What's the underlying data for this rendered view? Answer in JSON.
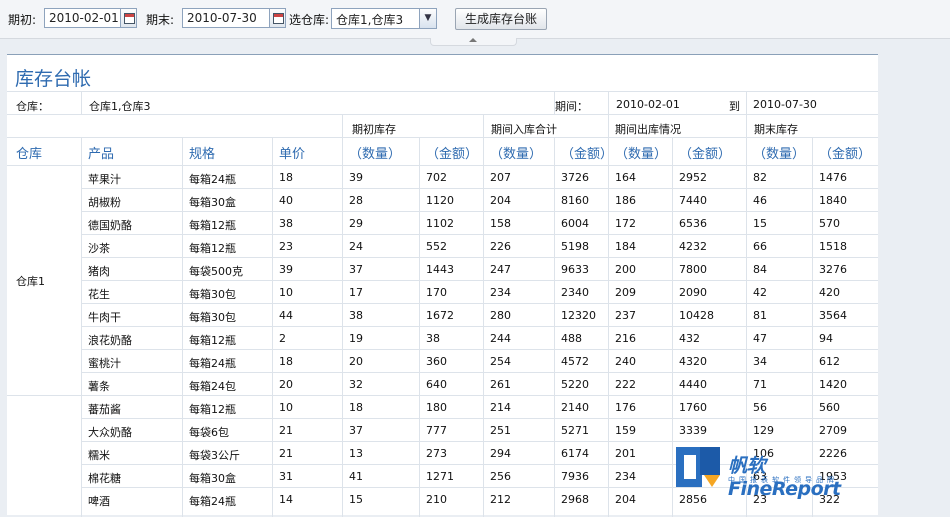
{
  "toolbar": {
    "start_label": "期初:",
    "start_value": "2010-02-01",
    "end_label": "期末:",
    "end_value": "2010-07-30",
    "warehouse_label": "选仓库:",
    "warehouse_value": "仓库1,仓库3",
    "generate_button": "生成库存台账"
  },
  "report": {
    "title": "库存台帐",
    "warehouse_label": "仓库：",
    "warehouse_value": "仓库1,仓库3",
    "period_label": "期间：",
    "period_start": "2010-02-01",
    "to_label": "到",
    "period_end": "2010-07-30",
    "group_headers": [
      "期初库存",
      "期间入库合计",
      "期间出库情况",
      "期末库存"
    ],
    "columns": [
      "仓库",
      "产品",
      "规格",
      "单价",
      "（数量）",
      "（金额）",
      "（数量）",
      "（金额）",
      "（数量）",
      "（金额）",
      "（数量）",
      "（金额）"
    ],
    "groups": [
      {
        "warehouse": "仓库1",
        "rows": [
          [
            "苹果汁",
            "每箱24瓶",
            "18",
            "39",
            "702",
            "207",
            "3726",
            "164",
            "2952",
            "82",
            "1476"
          ],
          [
            "胡椒粉",
            "每箱30盒",
            "40",
            "28",
            "1120",
            "204",
            "8160",
            "186",
            "7440",
            "46",
            "1840"
          ],
          [
            "德国奶酪",
            "每箱12瓶",
            "38",
            "29",
            "1102",
            "158",
            "6004",
            "172",
            "6536",
            "15",
            "570"
          ],
          [
            "沙茶",
            "每箱12瓶",
            "23",
            "24",
            "552",
            "226",
            "5198",
            "184",
            "4232",
            "66",
            "1518"
          ],
          [
            "猪肉",
            "每袋500克",
            "39",
            "37",
            "1443",
            "247",
            "9633",
            "200",
            "7800",
            "84",
            "3276"
          ],
          [
            "花生",
            "每箱30包",
            "10",
            "17",
            "170",
            "234",
            "2340",
            "209",
            "2090",
            "42",
            "420"
          ],
          [
            "牛肉干",
            "每箱30包",
            "44",
            "38",
            "1672",
            "280",
            "12320",
            "237",
            "10428",
            "81",
            "3564"
          ],
          [
            "浪花奶酪",
            "每箱12瓶",
            "2",
            "19",
            "38",
            "244",
            "488",
            "216",
            "432",
            "47",
            "94"
          ],
          [
            "蜜桃汁",
            "每箱24瓶",
            "18",
            "20",
            "360",
            "254",
            "4572",
            "240",
            "4320",
            "34",
            "612"
          ],
          [
            "薯条",
            "每箱24包",
            "20",
            "32",
            "640",
            "261",
            "5220",
            "222",
            "4440",
            "71",
            "1420"
          ]
        ]
      },
      {
        "warehouse": "",
        "rows": [
          [
            "蕃茄酱",
            "每箱12瓶",
            "10",
            "18",
            "180",
            "214",
            "2140",
            "176",
            "1760",
            "56",
            "560"
          ],
          [
            "大众奶酪",
            "每袋6包",
            "21",
            "37",
            "777",
            "251",
            "5271",
            "159",
            "3339",
            "129",
            "2709"
          ],
          [
            "糯米",
            "每袋3公斤",
            "21",
            "13",
            "273",
            "294",
            "6174",
            "201",
            "",
            "106",
            "2226"
          ],
          [
            "棉花糖",
            "每箱30盒",
            "31",
            "41",
            "1271",
            "256",
            "7936",
            "234",
            "",
            "63",
            "1953"
          ],
          [
            "啤酒",
            "每箱24瓶",
            "14",
            "15",
            "210",
            "212",
            "2968",
            "204",
            "2856",
            "23",
            "322"
          ]
        ]
      }
    ]
  },
  "watermark": {
    "brand": "帆软FineReport",
    "tagline": "中国报表软件领导品牌"
  },
  "colors": {
    "accent": "#2f6bb0",
    "background": "#eaeef3",
    "grid": "#dde3ea"
  }
}
